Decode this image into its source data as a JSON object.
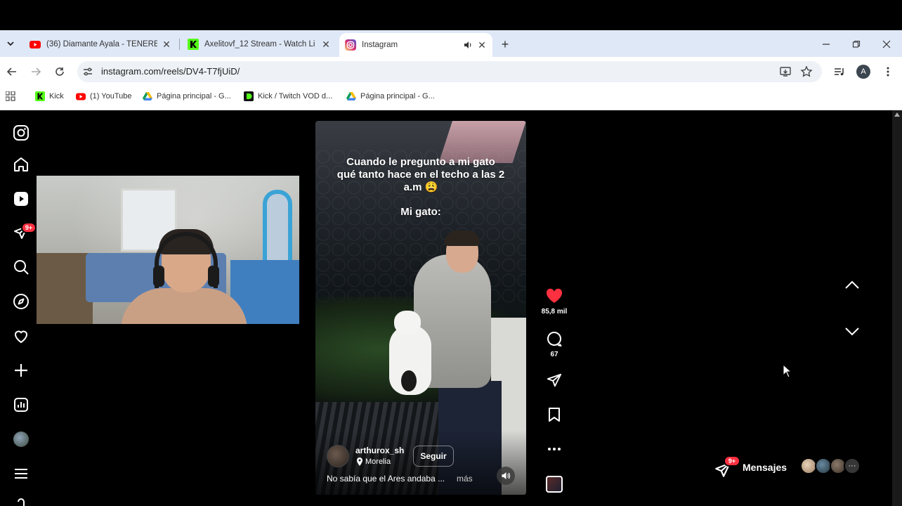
{
  "browser": {
    "tabs": [
      {
        "title": "(36) Diamante Ayala - TENERE |",
        "favicon": "youtube-icon"
      },
      {
        "title": "Axelitovf_12 Stream - Watch Li",
        "favicon": "kick-icon"
      },
      {
        "title": "Instagram",
        "favicon": "instagram-icon",
        "active": true,
        "audio": true
      }
    ],
    "url": "instagram.com/reels/DV4-T7fjUiD/",
    "profile_initial": "A",
    "bookmarks": [
      {
        "label": "Kick",
        "icon": "kick-icon"
      },
      {
        "label": "(1) YouTube",
        "icon": "youtube-icon"
      },
      {
        "label": "Página principal - G...",
        "icon": "drive-icon"
      },
      {
        "label": "Kick / Twitch VOD d...",
        "icon": "vod-icon"
      },
      {
        "label": "Página principal - G...",
        "icon": "drive-icon"
      }
    ]
  },
  "sidebar": {
    "notification_badge": "9+",
    "items": [
      "instagram-logo-icon",
      "home-icon",
      "reels-icon",
      "messages-icon",
      "search-icon",
      "explore-icon",
      "heart-icon",
      "create-icon",
      "dashboard-icon",
      "profile-avatar",
      "menu-icon"
    ]
  },
  "reel": {
    "caption_line1": "Cuando le pregunto a mi gato qué tanto hace en el techo a las 2 a.m 😩",
    "caption_line2": "Mi gato:",
    "author": "arthurox_sh",
    "location": "Morelia",
    "follow_label": "Seguir",
    "description": "No sabía que el Ares andaba ...",
    "more_label": "más",
    "likes": "85,8 mil",
    "comments": "67"
  },
  "messages": {
    "label": "Mensajes",
    "badge": "9+",
    "more": "···"
  },
  "colors": {
    "like_red": "#ff3040",
    "tabstrip": "#dfe8f7",
    "page_bg": "#000000"
  }
}
